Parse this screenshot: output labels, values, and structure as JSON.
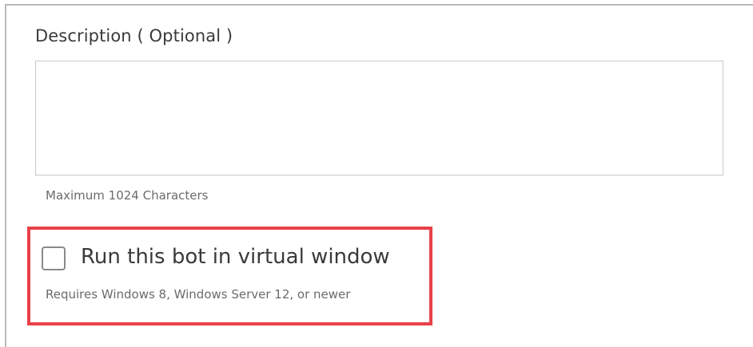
{
  "description": {
    "label": "Description ( Optional )",
    "value": "",
    "placeholder": "",
    "hint": "Maximum 1024 Characters"
  },
  "virtual_window": {
    "label": "Run this bot in virtual window",
    "checked": false,
    "hint": "Requires Windows 8, Windows Server 12, or newer"
  },
  "colors": {
    "highlight": "#e8414a",
    "border": "#c9c9c9",
    "text": "#3a3a3a",
    "muted_text": "#6b6b6b"
  }
}
